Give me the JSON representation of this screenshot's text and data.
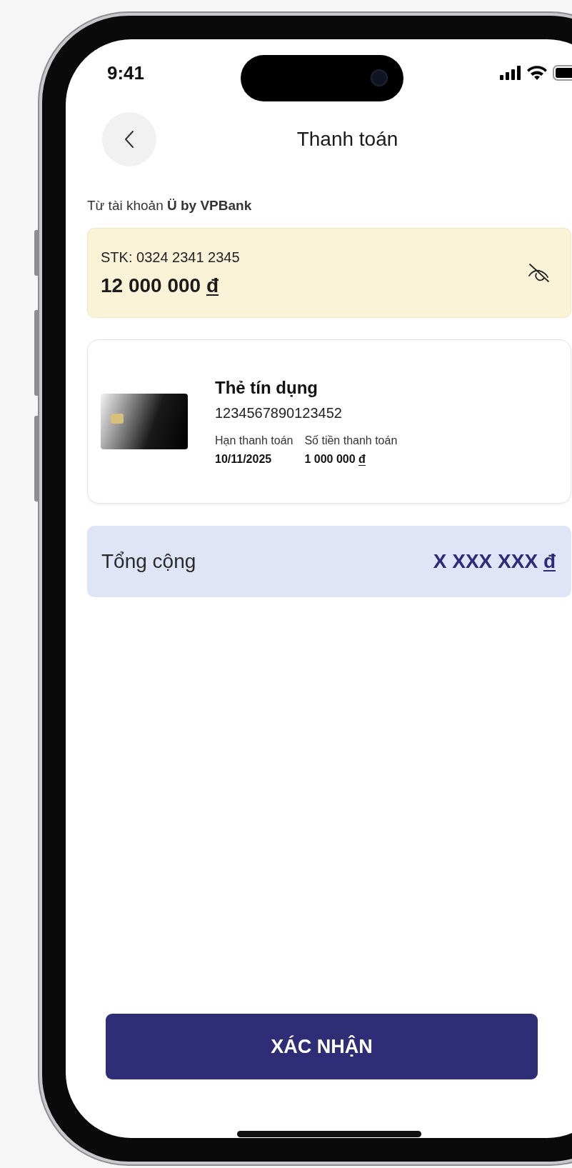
{
  "status_bar": {
    "time": "9:41"
  },
  "header": {
    "title": "Thanh toán"
  },
  "source": {
    "text": "Từ tài khoản **Ü by VPBank**"
  },
  "account": {
    "number": "STK: 0324 2341 2345",
    "balance": "12 000 000",
    "currency": "đ"
  },
  "card": {
    "title": "Thẻ tín dụng",
    "number": "1234567890123452",
    "fields": [
      {
        "label": "Hạn thanh toán",
        "value": "10/11/2025"
      },
      {
        "label": "Số tiền thanh toán",
        "value": "1 000 000",
        "currency": "đ"
      }
    ]
  },
  "total": {
    "label": "Tổng cộng",
    "value": "X XXX XXX",
    "currency": "đ"
  },
  "confirm_button": {
    "label": "XÁC NHẬN"
  }
}
